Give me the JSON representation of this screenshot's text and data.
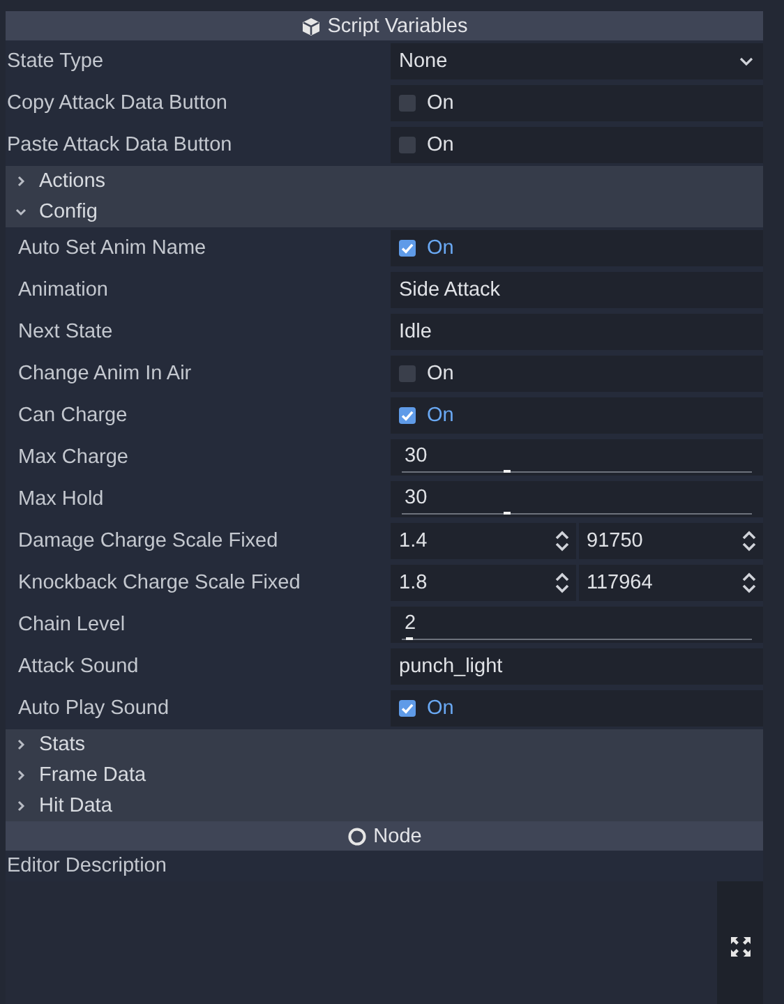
{
  "inspector": [
    {
      "kind": "category",
      "title": "Script Variables"
    },
    {
      "kind": "property",
      "label": "State Type",
      "editor": {
        "kind": "enum",
        "value": "None"
      }
    },
    {
      "kind": "property",
      "label": "Copy Attack Data Button",
      "editor": {
        "kind": "check",
        "checked": false,
        "text": "On"
      }
    },
    {
      "kind": "property",
      "label": "Paste Attack Data Button",
      "editor": {
        "kind": "check",
        "checked": false,
        "text": "On"
      }
    },
    {
      "kind": "group",
      "label": "Actions",
      "expanded": false
    },
    {
      "kind": "group",
      "label": "Config",
      "expanded": true,
      "children": [
        {
          "kind": "property",
          "label": "Auto Set Anim Name",
          "editor": {
            "kind": "check",
            "checked": true,
            "text": "On"
          }
        },
        {
          "kind": "property",
          "label": "Animation",
          "editor": {
            "kind": "text",
            "value": "Side Attack"
          }
        },
        {
          "kind": "property",
          "label": "Next State",
          "editor": {
            "kind": "text",
            "value": "Idle"
          }
        },
        {
          "kind": "property",
          "label": "Change Anim In Air",
          "editor": {
            "kind": "check",
            "checked": false,
            "text": "On"
          }
        },
        {
          "kind": "property",
          "label": "Can Charge",
          "editor": {
            "kind": "check",
            "checked": true,
            "text": "On"
          }
        },
        {
          "kind": "property",
          "label": "Max Charge",
          "editor": {
            "kind": "slider",
            "value": "30",
            "level": 0.3
          }
        },
        {
          "kind": "property",
          "label": "Max Hold",
          "editor": {
            "kind": "slider",
            "value": "30",
            "level": 0.3
          }
        },
        {
          "kind": "property",
          "label": "Damage Charge Scale Fixed",
          "editor": {
            "kind": "pair",
            "values": [
              "1.4",
              "91750"
            ]
          }
        },
        {
          "kind": "property",
          "label": "Knockback Charge Scale Fixed",
          "editor": {
            "kind": "pair",
            "values": [
              "1.8",
              "117964"
            ]
          }
        },
        {
          "kind": "property",
          "label": "Chain Level",
          "editor": {
            "kind": "slider",
            "value": "2",
            "level": 0.02
          }
        },
        {
          "kind": "property",
          "label": "Attack Sound",
          "editor": {
            "kind": "text",
            "value": "punch_light"
          }
        },
        {
          "kind": "property",
          "label": "Auto Play Sound",
          "editor": {
            "kind": "check",
            "checked": true,
            "text": "On"
          }
        }
      ]
    },
    {
      "kind": "group",
      "label": "Stats",
      "expanded": false
    },
    {
      "kind": "group",
      "label": "Frame Data",
      "expanded": false
    },
    {
      "kind": "group",
      "label": "Hit Data",
      "expanded": false
    },
    {
      "kind": "category",
      "title": "Node"
    },
    {
      "kind": "property",
      "label": "Editor Description",
      "editor": {
        "kind": "textarea"
      }
    }
  ]
}
